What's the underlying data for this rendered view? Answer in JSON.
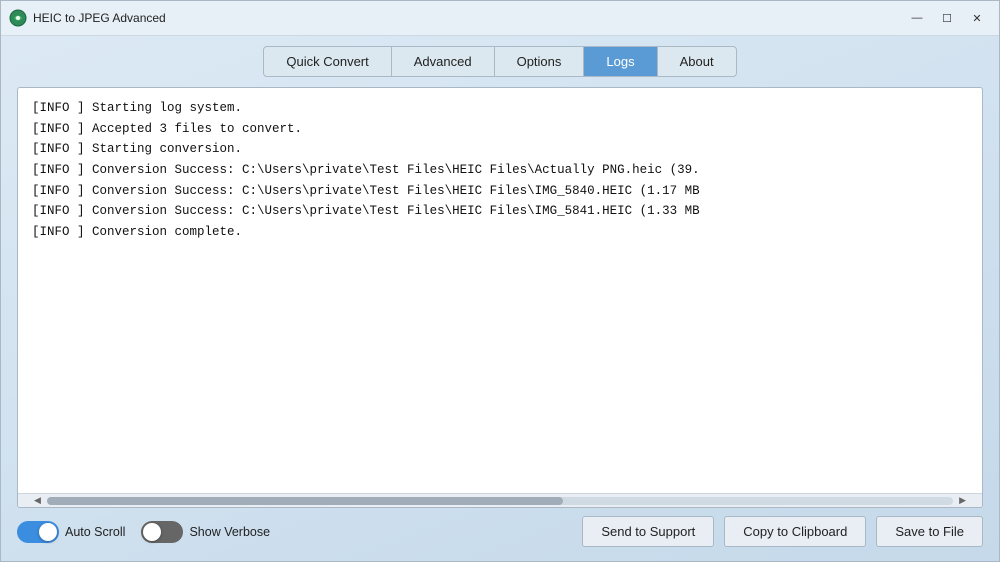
{
  "window": {
    "title": "HEIC to JPEG Advanced",
    "controls": {
      "minimize": "—",
      "maximize": "☐",
      "close": "✕"
    }
  },
  "tabs": [
    {
      "id": "quick-convert",
      "label": "Quick Convert",
      "active": false
    },
    {
      "id": "advanced",
      "label": "Advanced",
      "active": false
    },
    {
      "id": "options",
      "label": "Options",
      "active": false
    },
    {
      "id": "logs",
      "label": "Logs",
      "active": true
    },
    {
      "id": "about",
      "label": "About",
      "active": false
    }
  ],
  "log": {
    "lines": [
      "[INFO    ] Starting log system.",
      "[INFO    ] Accepted 3 files to convert.",
      "[INFO    ] Starting conversion.",
      "[INFO    ] Conversion Success: C:\\Users\\private\\Test Files\\HEIC Files\\Actually PNG.heic (39.",
      "[INFO    ] Conversion Success: C:\\Users\\private\\Test Files\\HEIC Files\\IMG_5840.HEIC (1.17 MB",
      "[INFO    ] Conversion Success: C:\\Users\\private\\Test Files\\HEIC Files\\IMG_5841.HEIC (1.33 MB",
      "[INFO    ] Conversion complete."
    ],
    "scrollbar": {
      "thumb_width_pct": 57
    }
  },
  "controls": {
    "auto_scroll": {
      "label": "Auto Scroll",
      "enabled": true
    },
    "show_verbose": {
      "label": "Show Verbose",
      "enabled": false
    },
    "buttons": {
      "send_support": "Send to Support",
      "copy_clipboard": "Copy to Clipboard",
      "save_file": "Save to File"
    }
  }
}
